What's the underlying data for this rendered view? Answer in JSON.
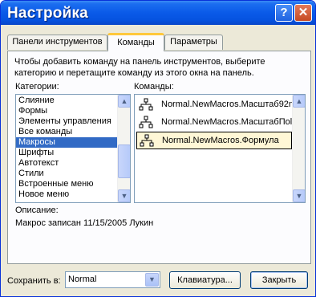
{
  "window": {
    "title": "Настройка",
    "help_label": "?",
    "close_label": "✕"
  },
  "tabs": [
    {
      "label": "Панели инструментов"
    },
    {
      "label": "Команды"
    },
    {
      "label": "Параметры"
    }
  ],
  "commands_tab": {
    "intro_line1": "Чтобы добавить команду на панель инструментов, выберите",
    "intro_line2": "категорию и перетащите команду из этого окна на панель.",
    "categories_label": "Категории:",
    "commands_label": "Команды:",
    "categories": [
      {
        "label": "Слияние"
      },
      {
        "label": "Формы"
      },
      {
        "label": "Элементы управления"
      },
      {
        "label": "Все команды"
      },
      {
        "label": "Макросы"
      },
      {
        "label": "Шрифты"
      },
      {
        "label": "Автотекст"
      },
      {
        "label": "Стили"
      },
      {
        "label": "Встроенные меню"
      },
      {
        "label": "Новое меню"
      }
    ],
    "selected_category": "Макросы",
    "commands": [
      {
        "label": "Normal.NewMacros.Масштаб92n",
        "icon": "macro-icon"
      },
      {
        "label": "Normal.NewMacros.МасштабПоl",
        "icon": "macro-icon"
      },
      {
        "label": "Normal.NewMacros.Формула",
        "icon": "macro-icon"
      }
    ],
    "selected_command": "Normal.NewMacros.Формула",
    "description_label": "Описание:",
    "description_text": "Макрос записан 11/15/2005 Лукин"
  },
  "footer": {
    "save_in_label": "Сохранить в:",
    "save_in_value": "Normal",
    "keyboard_button": "Клавиатура...",
    "close_button": "Закрыть"
  },
  "colors": {
    "titlebar": "#0a5ae8",
    "selection": "#316ac5",
    "dialog_bg": "#ece9d8"
  }
}
